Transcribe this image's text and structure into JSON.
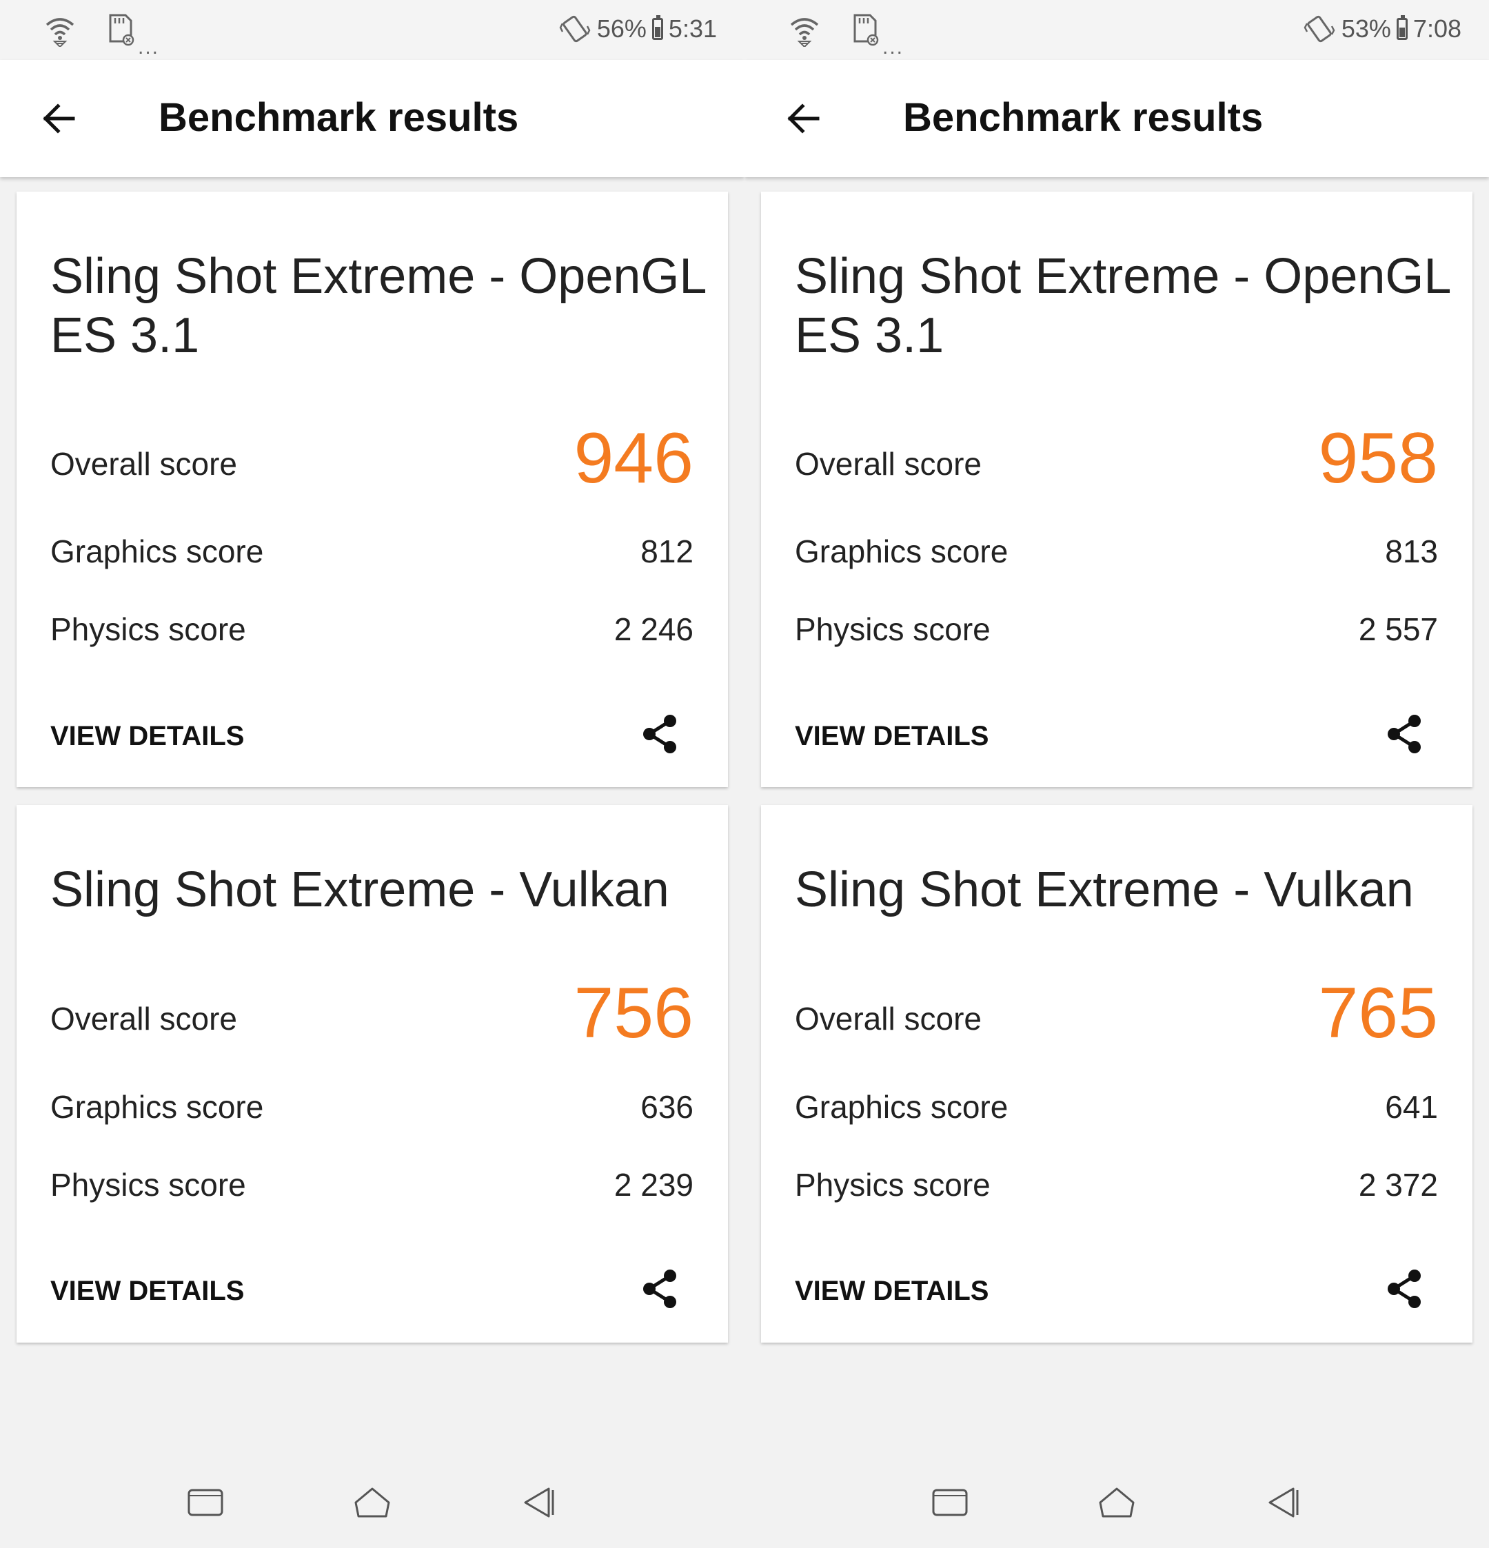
{
  "screens": [
    {
      "status": {
        "battery": "56%",
        "time": "5:31",
        "dots": "..."
      },
      "appbar": {
        "title": "Benchmark results"
      },
      "cards": [
        {
          "title": "Sling Shot Extreme - OpenGL ES 3.1",
          "overall_label": "Overall score",
          "overall_value": "946",
          "graphics_label": "Graphics score",
          "graphics_value": "812",
          "physics_label": "Physics score",
          "physics_value": "2 246",
          "details_label": "VIEW DETAILS"
        },
        {
          "title": "Sling Shot Extreme - Vulkan",
          "overall_label": "Overall score",
          "overall_value": "756",
          "graphics_label": "Graphics score",
          "graphics_value": "636",
          "physics_label": "Physics score",
          "physics_value": "2 239",
          "details_label": "VIEW DETAILS"
        }
      ]
    },
    {
      "status": {
        "battery": "53%",
        "time": "7:08",
        "dots": "..."
      },
      "appbar": {
        "title": "Benchmark results"
      },
      "cards": [
        {
          "title": "Sling Shot Extreme - OpenGL ES 3.1",
          "overall_label": "Overall score",
          "overall_value": "958",
          "graphics_label": "Graphics score",
          "graphics_value": "813",
          "physics_label": "Physics score",
          "physics_value": "2 557",
          "details_label": "VIEW DETAILS"
        },
        {
          "title": "Sling Shot Extreme - Vulkan",
          "overall_label": "Overall score",
          "overall_value": "765",
          "graphics_label": "Graphics score",
          "graphics_value": "641",
          "physics_label": "Physics score",
          "physics_value": "2 372",
          "details_label": "VIEW DETAILS"
        }
      ]
    }
  ],
  "colors": {
    "accent": "#f47b20",
    "text": "#222222",
    "background": "#f2f2f2"
  },
  "icons": [
    "wifi-icon",
    "sd-card-icon",
    "vibrate-icon",
    "battery-icon",
    "back-arrow-icon",
    "share-icon",
    "recents-icon",
    "home-icon",
    "back-icon"
  ]
}
